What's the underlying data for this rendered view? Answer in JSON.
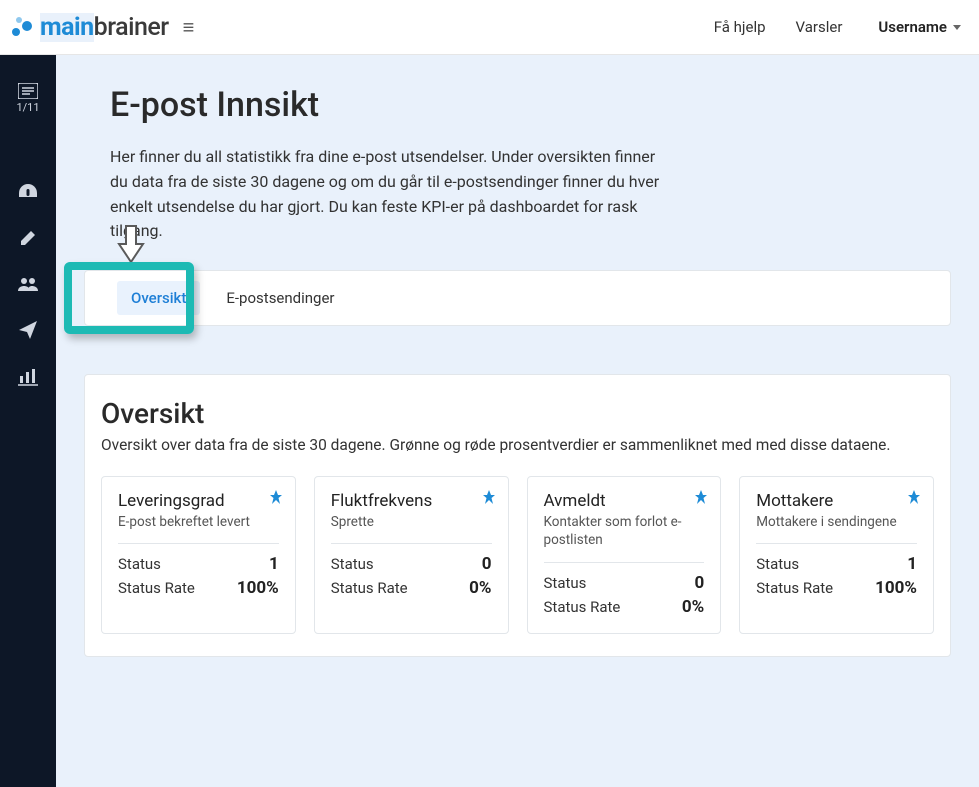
{
  "topbar": {
    "help_label": "Få hjelp",
    "alerts_label": "Varsler",
    "username": "Username"
  },
  "logo": {
    "part1": "main",
    "part2": "brainer"
  },
  "sidebar": {
    "step_label": "1/11"
  },
  "page": {
    "title": "E-post Innsikt",
    "description": "Her finner du all statistikk fra dine e-post utsendelser. Under oversikten finner du data fra de siste 30 dagene og om du går til e-postsendinger finner du hver enkelt utsendelse du har gjort. Du kan feste KPI-er på dashboardet for rask tilgang."
  },
  "tabs": {
    "overview": "Oversikt",
    "sendings": "E-postsendinger"
  },
  "overview": {
    "title": "Oversikt",
    "description": "Oversikt over data fra de siste 30 dagene. Grønne og røde prosentverdier er sammenliknet med med disse dataene.",
    "status_label": "Status",
    "rate_label": "Status Rate",
    "cards": [
      {
        "name": "Leveringsgrad",
        "sub": "E-post bekreftet levert",
        "status": "1",
        "rate": "100%"
      },
      {
        "name": "Fluktfrekvens",
        "sub": "Sprette",
        "status": "0",
        "rate": "0%"
      },
      {
        "name": "Avmeldt",
        "sub": "Kontakter som forlot e-postlisten",
        "status": "0",
        "rate": "0%"
      },
      {
        "name": "Mottakere",
        "sub": "Mottakere i sendingene",
        "status": "1",
        "rate": "100%"
      }
    ]
  }
}
